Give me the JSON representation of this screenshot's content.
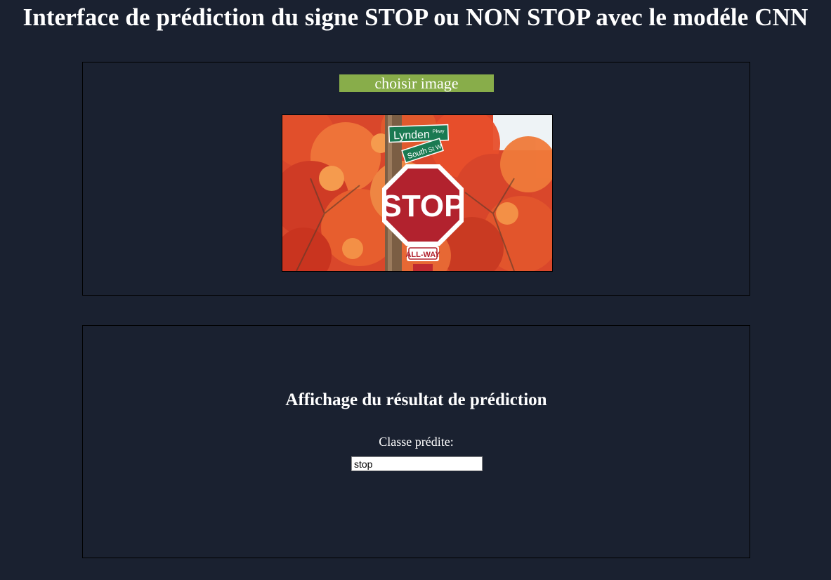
{
  "page": {
    "title": "Interface de prédiction du signe STOP ou NON STOP avec le modéle CNN"
  },
  "upload": {
    "button_label": "choisir image",
    "preview_icon": "stop-sign-photo",
    "preview_sign_texts": {
      "street_1": "Lynden",
      "street_1_suffix": "Pkwy",
      "street_2": "South",
      "street_2_suffix": "St W",
      "stop": "STOP",
      "plate": "ALL-WAY"
    }
  },
  "result": {
    "heading": "Affichage du résultat de prédiction",
    "class_label": "Classe prédite:",
    "class_value": "stop"
  },
  "colors": {
    "background": "#1a2130",
    "button": "#88ad4a",
    "text": "#ffffff",
    "stop_red": "#b2222e",
    "foliage": "#e0462a",
    "street_sign": "#1a7a52"
  }
}
